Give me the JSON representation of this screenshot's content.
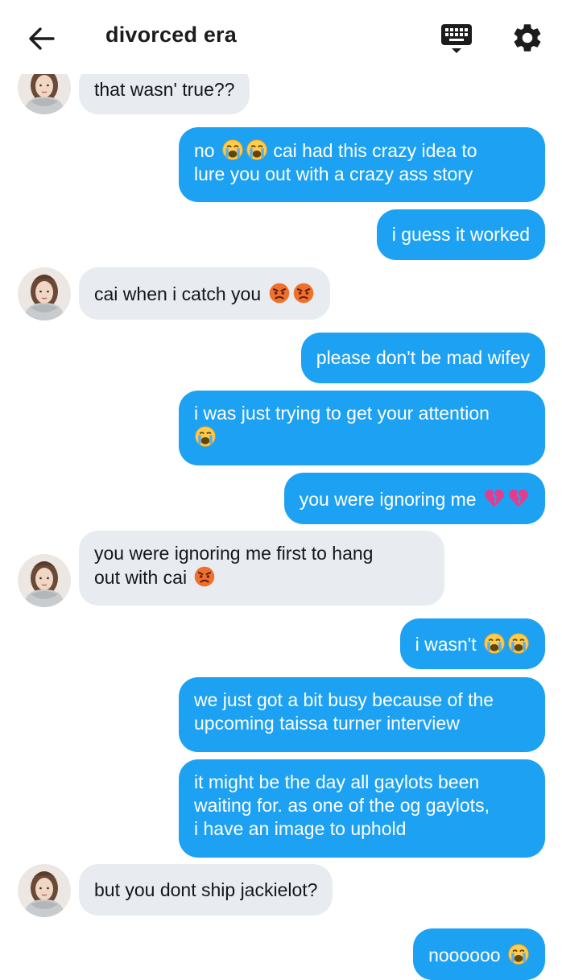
{
  "header": {
    "title": "divorced era",
    "back_icon": "arrow-left-icon",
    "keyboard_icon": "keyboard-icon",
    "settings_icon": "gear-icon"
  },
  "colors": {
    "outgoing_bubble": "#1da1f2",
    "incoming_bubble": "#e8ecf0",
    "text_dark": "#14171a"
  },
  "messages": [
    {
      "side": "in",
      "text": "that wasn' true??",
      "text_line2": "",
      "emojis": [],
      "emoji_line": 1
    },
    {
      "side": "out",
      "text": "no",
      "text_after": "cai had this crazy idea to",
      "text_line2": "lure you out with a crazy ass story",
      "emojis": [
        "crying"
      ],
      "emoji_count": 2
    },
    {
      "side": "out",
      "text": "i guess it worked"
    },
    {
      "side": "in",
      "text": "cai when i catch you",
      "emojis": [
        "angry",
        "angry"
      ]
    },
    {
      "side": "out",
      "text": "please don't be mad wifey"
    },
    {
      "side": "out",
      "text": "i was just trying to get your attention",
      "emojis": [
        "crying"
      ],
      "emoji_line": 2
    },
    {
      "side": "out",
      "text": "you were ignoring me",
      "emojis": [
        "broken-heart",
        "broken-heart"
      ]
    },
    {
      "side": "in",
      "text": "you were ignoring me first to hang",
      "text_line2": "out with cai",
      "emojis": [
        "angry"
      ]
    },
    {
      "side": "out",
      "text": "i wasn't",
      "emojis": [
        "crying",
        "crying"
      ]
    },
    {
      "side": "out",
      "text": "we just got a bit busy because of the",
      "text_line2": "upcoming taissa turner interview"
    },
    {
      "side": "out",
      "text": "it might be the day all gaylots been",
      "text_line2": "waiting for. as one of the og gaylots,",
      "text_line3": "i have an image to uphold"
    },
    {
      "side": "in",
      "text": "but you dont ship jackielot?"
    },
    {
      "side": "out",
      "text": "noooooo",
      "emojis": [
        "crying"
      ]
    }
  ]
}
